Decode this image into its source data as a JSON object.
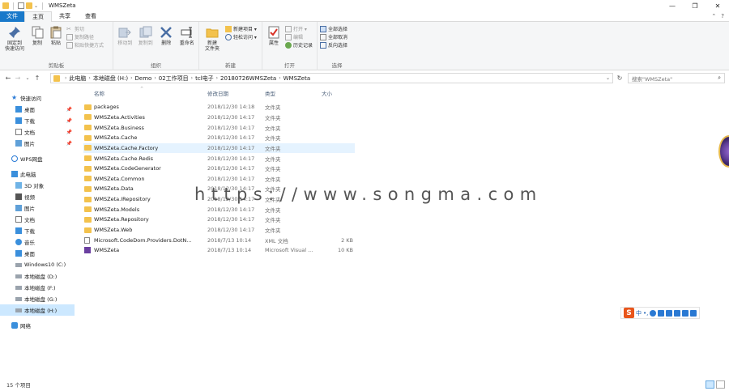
{
  "window": {
    "title": "WMSZeta",
    "minimize_glyph": "—",
    "maximize_glyph": "❐",
    "close_glyph": "✕"
  },
  "tabs": [
    {
      "label": "文件"
    },
    {
      "label": "主页"
    },
    {
      "label": "共享"
    },
    {
      "label": "查看"
    }
  ],
  "tabs_right": {
    "collapse_glyph": "⌃",
    "help_glyph": "?"
  },
  "ribbon": {
    "clipboard": {
      "label": "剪贴板",
      "pin": "固定到\n快速访问",
      "copy": "复制",
      "paste": "粘贴",
      "cut": "剪切",
      "copy_path": "复制路径",
      "paste_shortcut": "粘贴快捷方式"
    },
    "organize": {
      "label": "组织",
      "move_to": "移动到",
      "copy_to": "复制到",
      "delete": "删除",
      "rename": "重命名"
    },
    "new": {
      "label": "新建",
      "new_folder": "新建\n文件夹",
      "new_item": "新建项目 ▾",
      "easy_access": "轻松访问 ▾"
    },
    "open": {
      "label": "打开",
      "properties": "属性",
      "open": "打开 ▾",
      "edit": "编辑",
      "history": "历史记录"
    },
    "select": {
      "label": "选择",
      "select_all": "全部选择",
      "select_none": "全部取消",
      "invert": "反向选择"
    }
  },
  "nav": {
    "back": "←",
    "forward": "→",
    "recent": "⌄",
    "up": "↑",
    "breadcrumb": [
      "此电脑",
      "本地磁盘 (H:)",
      "Demo",
      "02工作项目",
      "tcl电子",
      "20180726WMSZeta",
      "WMSZeta"
    ],
    "dropdown": "⌄",
    "refresh": "↻",
    "search_placeholder": "搜索\"WMSZeta\"",
    "search_icon": "⌕"
  },
  "sidebar": [
    {
      "label": "快速访问",
      "icon": "star-icon",
      "level": 1,
      "pin": ""
    },
    {
      "label": "桌面",
      "icon": "desktop-icon",
      "level": 2,
      "pin": "📌"
    },
    {
      "label": "下载",
      "icon": "download-icon",
      "level": 2,
      "pin": "📌"
    },
    {
      "label": "文档",
      "icon": "documents-icon",
      "level": 2,
      "pin": "📌"
    },
    {
      "label": "图片",
      "icon": "pictures-icon",
      "level": 2,
      "pin": "📌"
    },
    {
      "label": "",
      "icon": "",
      "level": 0,
      "pin": ""
    },
    {
      "label": "WPS网盘",
      "icon": "cloud-icon",
      "level": 1,
      "pin": ""
    },
    {
      "label": "",
      "icon": "",
      "level": 0,
      "pin": ""
    },
    {
      "label": "此电脑",
      "icon": "computer-icon",
      "level": 1,
      "pin": ""
    },
    {
      "label": "3D 对象",
      "icon": "cube-icon",
      "level": 2,
      "pin": ""
    },
    {
      "label": "视频",
      "icon": "video-icon",
      "level": 2,
      "pin": ""
    },
    {
      "label": "图片",
      "icon": "pictures-icon",
      "level": 2,
      "pin": ""
    },
    {
      "label": "文档",
      "icon": "documents-icon",
      "level": 2,
      "pin": ""
    },
    {
      "label": "下载",
      "icon": "download-icon",
      "level": 2,
      "pin": ""
    },
    {
      "label": "音乐",
      "icon": "music-icon",
      "level": 2,
      "pin": ""
    },
    {
      "label": "桌面",
      "icon": "desktop-icon",
      "level": 2,
      "pin": ""
    },
    {
      "label": "Windows10 (C:)",
      "icon": "drive-icon",
      "level": 2,
      "pin": ""
    },
    {
      "label": "本地磁盘 (D:)",
      "icon": "drive-icon",
      "level": 2,
      "pin": ""
    },
    {
      "label": "本地磁盘 (F:)",
      "icon": "drive-icon",
      "level": 2,
      "pin": ""
    },
    {
      "label": "本地磁盘 (G:)",
      "icon": "drive-icon",
      "level": 2,
      "pin": ""
    },
    {
      "label": "本地磁盘 (H:)",
      "icon": "drive-icon",
      "level": 2,
      "pin": "",
      "selected": true
    },
    {
      "label": "",
      "icon": "",
      "level": 0,
      "pin": ""
    },
    {
      "label": "网络",
      "icon": "network-icon",
      "level": 1,
      "pin": ""
    }
  ],
  "columns": {
    "name": "名称",
    "date": "修改日期",
    "type": "类型",
    "size": "大小",
    "sort_glyph": "^"
  },
  "files": [
    {
      "name": "packages",
      "date": "2018/12/30 14:18",
      "type": "文件夹",
      "size": "",
      "icon": "folder-icon"
    },
    {
      "name": "WMSZeta.Activities",
      "date": "2018/12/30 14:17",
      "type": "文件夹",
      "size": "",
      "icon": "folder-icon"
    },
    {
      "name": "WMSZeta.Business",
      "date": "2018/12/30 14:17",
      "type": "文件夹",
      "size": "",
      "icon": "folder-icon"
    },
    {
      "name": "WMSZeta.Cache",
      "date": "2018/12/30 14:17",
      "type": "文件夹",
      "size": "",
      "icon": "folder-icon"
    },
    {
      "name": "WMSZeta.Cache.Factory",
      "date": "2018/12/30 14:17",
      "type": "文件夹",
      "size": "",
      "icon": "folder-icon",
      "hover": true
    },
    {
      "name": "WMSZeta.Cache.Redis",
      "date": "2018/12/30 14:17",
      "type": "文件夹",
      "size": "",
      "icon": "folder-icon"
    },
    {
      "name": "WMSZeta.CodeGenerator",
      "date": "2018/12/30 14:17",
      "type": "文件夹",
      "size": "",
      "icon": "folder-icon"
    },
    {
      "name": "WMSZeta.Common",
      "date": "2018/12/30 14:17",
      "type": "文件夹",
      "size": "",
      "icon": "folder-icon"
    },
    {
      "name": "WMSZeta.Data",
      "date": "2018/12/30 14:17",
      "type": "文件夹",
      "size": "",
      "icon": "folder-icon"
    },
    {
      "name": "WMSZeta.IRepository",
      "date": "2018/12/30 14:17",
      "type": "文件夹",
      "size": "",
      "icon": "folder-icon"
    },
    {
      "name": "WMSZeta.Models",
      "date": "2018/12/30 14:17",
      "type": "文件夹",
      "size": "",
      "icon": "folder-icon"
    },
    {
      "name": "WMSZeta.Repository",
      "date": "2018/12/30 14:17",
      "type": "文件夹",
      "size": "",
      "icon": "folder-icon"
    },
    {
      "name": "WMSZeta.Web",
      "date": "2018/12/30 14:17",
      "type": "文件夹",
      "size": "",
      "icon": "folder-icon"
    },
    {
      "name": "Microsoft.CodeDom.Providers.DotN...",
      "date": "2018/7/13 10:14",
      "type": "XML 文档",
      "size": "2 KB",
      "icon": "xml-file-icon"
    },
    {
      "name": "WMSZeta",
      "date": "2018/7/13 10:14",
      "type": "Microsoft Visual ...",
      "size": "10 KB",
      "icon": "vs-solution-icon"
    }
  ],
  "watermark": "https://www.songma.com",
  "ime": {
    "logo": "S",
    "mode": "中",
    "punct": "•,",
    "icons": [
      "emoji-icon",
      "mic-icon",
      "keyboard-icon",
      "voice-icon",
      "shirt-icon",
      "grid-icon"
    ]
  },
  "status": {
    "item_count": "15 个项目"
  },
  "colors": {
    "accent": "#1979ca",
    "folder": "#f3c24d",
    "selected": "#cce8ff",
    "hover": "#e5f3ff"
  }
}
